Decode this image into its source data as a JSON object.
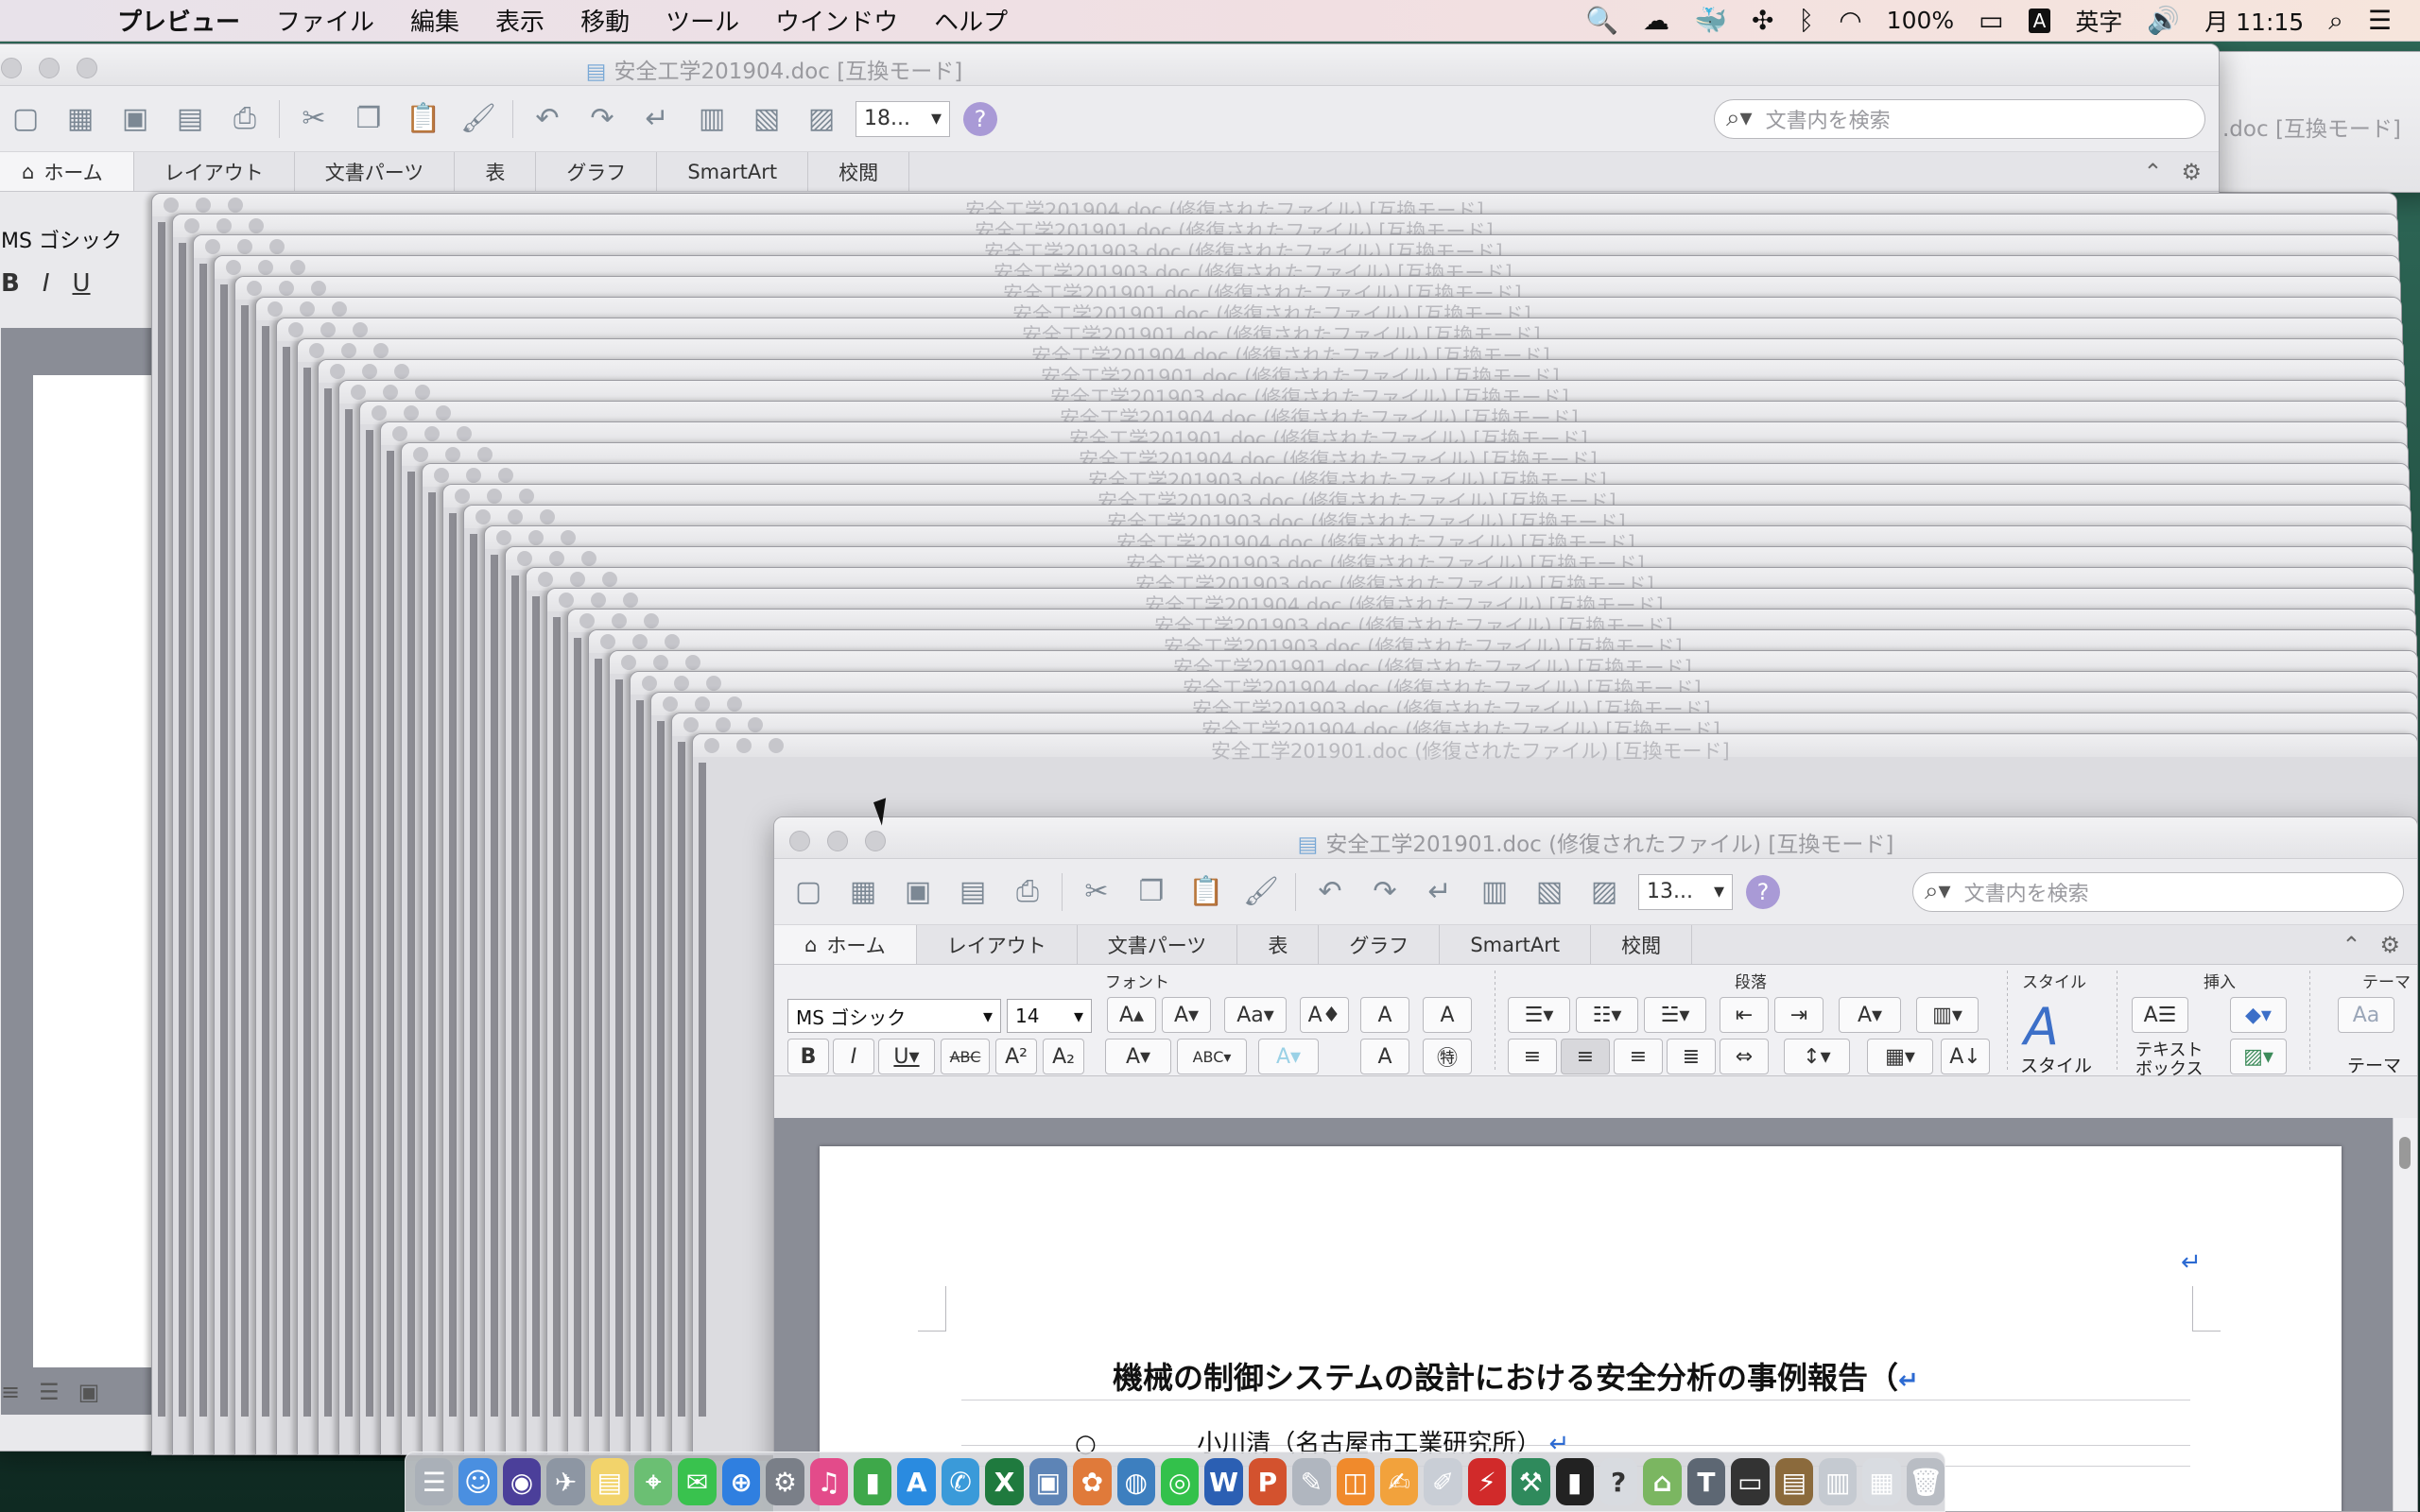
{
  "menubar": {
    "app_name": "プレビュー",
    "items": [
      "ファイル",
      "編集",
      "表示",
      "移動",
      "ツール",
      "ウインドウ",
      "ヘルプ"
    ],
    "battery": "100%",
    "input_mode": "A",
    "input_label": "英字",
    "clock": "月 11:15"
  },
  "back_window": {
    "title": "安全工学201904.doc [互換モード]",
    "zoom": "18...",
    "search_placeholder": "文書内を検索",
    "tabs": [
      "ホーム",
      "レイアウト",
      "文書パーツ",
      "表",
      "グラフ",
      "SmartArt",
      "校閲"
    ],
    "font_name": "MS ゴシック"
  },
  "far_window": {
    "title_fragment": ".doc [互換モード]"
  },
  "ghost_windows": {
    "titles": [
      "安全工学201904.doc (修復されたファイル) [互換モード]",
      "安全工学201901.doc (修復されたファイル) [互換モード]",
      "安全工学201903.doc (修復されたファイル) [互換モード]",
      "安全工学201903.doc (修復されたファイル) [互換モード]",
      "安全工学201901.doc (修復されたファイル) [互換モード]",
      "安全工学201901.doc (修復されたファイル) [互換モード]",
      "安全工学201901.doc (修復されたファイル) [互換モード]",
      "安全工学201904.doc (修復されたファイル) [互換モード]",
      "安全工学201901.doc (修復されたファイル) [互換モード]",
      "安全工学201903.doc (修復されたファイル) [互換モード]",
      "安全工学201904.doc (修復されたファイル) [互換モード]",
      "安全工学201901.doc (修復されたファイル) [互換モード]",
      "安全工学201904.doc (修復されたファイル) [互換モード]",
      "安全工学201903.doc (修復されたファイル) [互換モード]",
      "安全工学201903.doc (修復されたファイル) [互換モード]",
      "安全工学201903.doc (修復されたファイル) [互換モード]",
      "安全工学201904.doc (修復されたファイル) [互換モード]",
      "安全工学201903.doc (修復されたファイル) [互換モード]",
      "安全工学201903.doc (修復されたファイル) [互換モード]",
      "安全工学201904.doc (修復されたファイル) [互換モード]",
      "安全工学201903.doc (修復されたファイル) [互換モード]",
      "安全工学201903.doc (修復されたファイル) [互換モード]",
      "安全工学201901.doc (修復されたファイル) [互換モード]",
      "安全工学201904.doc (修復されたファイル) [互換モード]",
      "安全工学201903.doc (修復されたファイル) [互換モード]",
      "安全工学201904.doc (修復されたファイル) [互換モード]",
      "安全工学201901.doc (修復されたファイル) [互換モード]"
    ]
  },
  "front_window": {
    "title": "安全工学201901.doc (修復されたファイル) [互換モード]",
    "zoom": "13...",
    "search_placeholder": "文書内を検索",
    "tabs": [
      "ホーム",
      "レイアウト",
      "文書パーツ",
      "表",
      "グラフ",
      "SmartArt",
      "校閲"
    ],
    "ribbon": {
      "font_group_label": "フォント",
      "paragraph_group_label": "段落",
      "style_group_label": "スタイル",
      "insert_group_label": "挿入",
      "theme_group_label": "テーマ",
      "font_name": "MS ゴシック",
      "font_size": "14",
      "style_button_label": "スタイル",
      "textbox_label_line1": "テキスト",
      "textbox_label_line2": "ボックス",
      "theme_button_label": "テーマ",
      "theme_preview": "Aa"
    },
    "document": {
      "title": "機械の制御システムの設計における安全分析の事例報告（",
      "author_bullet": "○",
      "author": "小川清（名古屋市工業研究所）"
    }
  },
  "colors": {
    "menubar_gradient_start": "#e8e2ea",
    "doc_area": "#8a8d96",
    "help_icon": "#a99ad6",
    "paragraph_mark": "#2c6ad2"
  },
  "icons": {
    "menubar_right": [
      "magnifier-icon",
      "cloud-sync-icon",
      "docker-whale-icon",
      "app-icon",
      "bluetooth-icon",
      "wifi-icon",
      "battery-charging-icon",
      "volume-icon",
      "spotlight-icon",
      "notification-center-icon"
    ]
  }
}
